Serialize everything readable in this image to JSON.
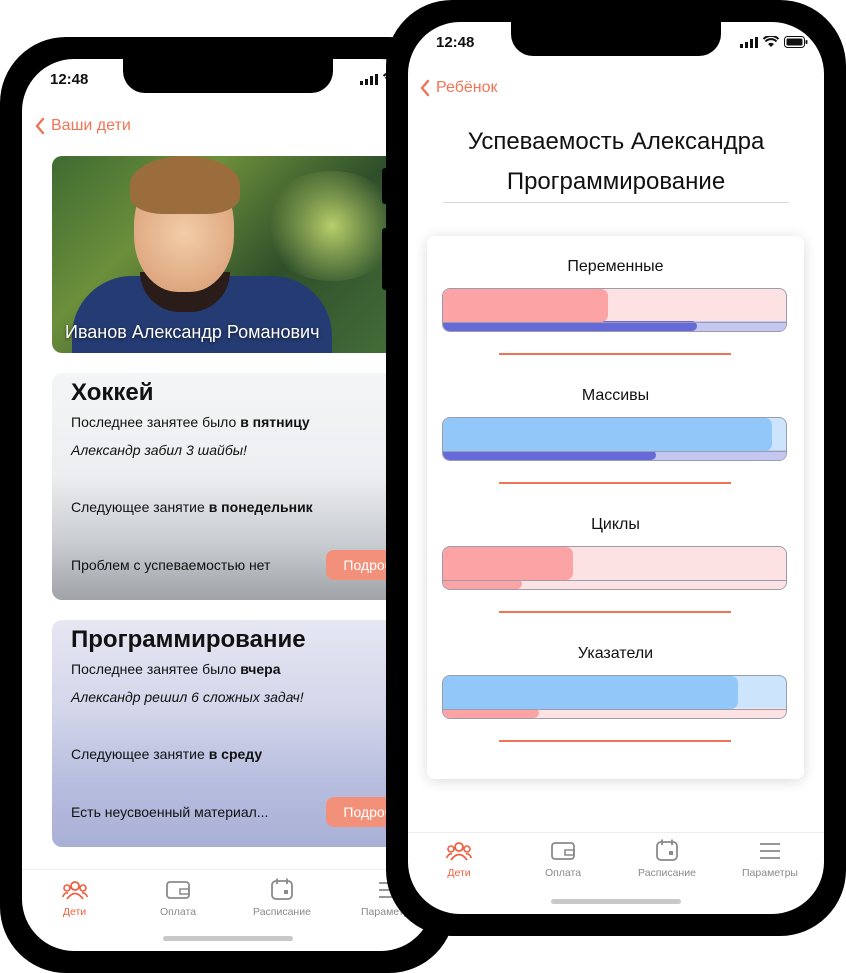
{
  "left_screen": {
    "status_time": "12:48",
    "back_label": "Ваши дети",
    "child_name": "Иванов Александр Романович",
    "cards": [
      {
        "title": "Хоккей",
        "last_prefix": "Последнее занятее было ",
        "last_day": "в пятницу",
        "note": "Александр забил 3 шайбы!",
        "next_prefix": "Следующее занятие ",
        "next_day": "в понедельник",
        "status": "Проблем с успеваемостью нет",
        "more": "Подробнее"
      },
      {
        "title": "Программирование",
        "last_prefix": "Последнее занятее было ",
        "last_day": "вчера",
        "note": "Александр решил 6 сложных задач!",
        "next_prefix": "Следующее занятие ",
        "next_day": "в среду",
        "status": "Есть неусвоенный материал...",
        "more": "Подробнее"
      }
    ],
    "tabs": [
      {
        "label": "Дети",
        "icon": "people-icon",
        "active": true
      },
      {
        "label": "Оплата",
        "icon": "wallet-icon",
        "active": false
      },
      {
        "label": "Расписание",
        "icon": "calendar-icon",
        "active": false
      },
      {
        "label": "Параметры",
        "icon": "menu-icon",
        "active": false
      }
    ]
  },
  "right_screen": {
    "status_time": "12:48",
    "back_label": "Ребёнок",
    "title_line1": "Успеваемость Александра",
    "title_line2": "Программирование",
    "metrics": [
      {
        "label": "Переменные",
        "upper_fill": 0.48,
        "lower_fill": 0.74,
        "upper_color": "#fca3a6",
        "upper_track": "#fde2e4",
        "lower_color": "#6669d8",
        "lower_track": "#c4c8f0"
      },
      {
        "label": "Массивы",
        "upper_fill": 0.96,
        "lower_fill": 0.62,
        "upper_color": "#92c7fa",
        "upper_track": "#cde4fd",
        "lower_color": "#6669d8",
        "lower_track": "#c4c8f0"
      },
      {
        "label": "Циклы",
        "upper_fill": 0.38,
        "lower_fill": 0.23,
        "upper_color": "#fca3a6",
        "upper_track": "#fde2e4",
        "lower_color": "#fca3a6",
        "lower_track": "#fde2e4"
      },
      {
        "label": "Указатели",
        "upper_fill": 0.86,
        "lower_fill": 0.28,
        "upper_color": "#92c7fa",
        "upper_track": "#cde4fd",
        "lower_color": "#fca3a6",
        "lower_track": "#fde2e4"
      }
    ],
    "tabs": [
      {
        "label": "Дети",
        "icon": "people-icon",
        "active": true
      },
      {
        "label": "Оплата",
        "icon": "wallet-icon",
        "active": false
      },
      {
        "label": "Расписание",
        "icon": "calendar-icon",
        "active": false
      },
      {
        "label": "Параметры",
        "icon": "menu-icon",
        "active": false
      }
    ]
  },
  "colors": {
    "accent": "#f07456",
    "tab_active": "#ef5e3d",
    "tab_inactive": "#8a8a8a",
    "button": "#f3907a"
  }
}
